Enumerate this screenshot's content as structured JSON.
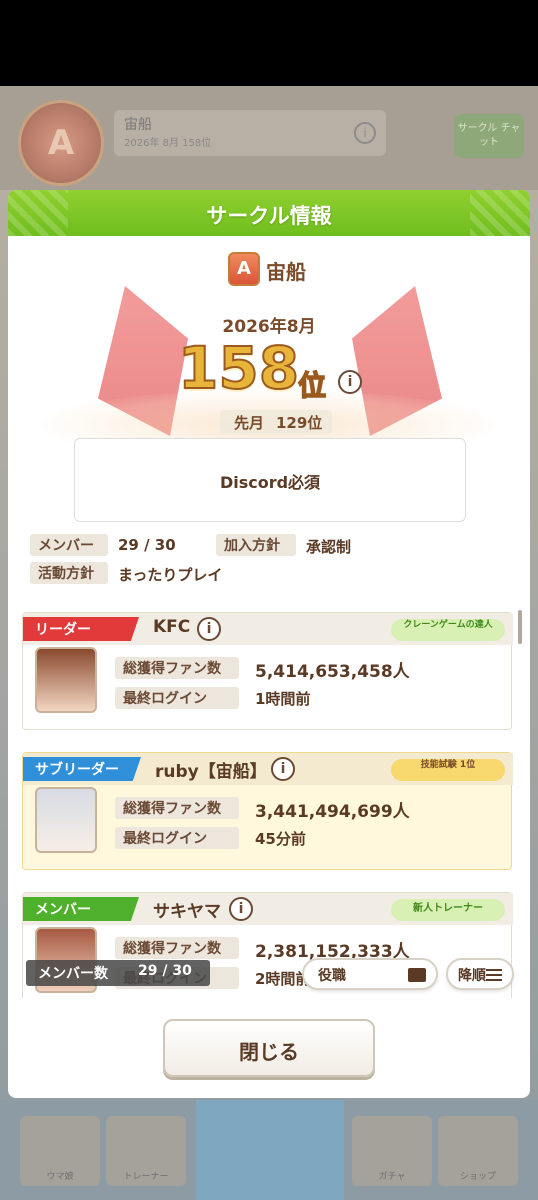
{
  "background": {
    "circle_name": "宙船",
    "circle_sub": "2026年 8月 158位",
    "side_button": "サークル\nチャット",
    "nav": [
      "ウマ娘",
      "トレーナー",
      "",
      "ガチャ",
      "ショップ"
    ]
  },
  "dialog": {
    "title": "サークル情報",
    "circle_rank_letter": "A",
    "circle_name": "宙船",
    "period": "2026年8月",
    "rank_number": "158",
    "rank_suffix": "位",
    "last_month_label": "先月",
    "last_month_value": "129位",
    "description": "Discord必須",
    "member_label": "メンバー",
    "member_value": "29 / 30",
    "join_policy_label": "加入方針",
    "join_policy_value": "承認制",
    "activity_label": "活動方針",
    "activity_value": "まったりプレイ"
  },
  "members": [
    {
      "role": "リーダー",
      "name": "KFC",
      "title_badge": "クレーンゲームの達人",
      "fans_label": "総獲得ファン数",
      "fans": "5,414,653,458人",
      "login_label": "最終ログイン",
      "login": "1時間前"
    },
    {
      "role": "サブリーダー",
      "name": "ruby【宙船】",
      "title_badge": "技能試験 1位",
      "fans_label": "総獲得ファン数",
      "fans": "3,441,494,699人",
      "login_label": "最終ログイン",
      "login": "45分前"
    },
    {
      "role": "メンバー",
      "name": "サキヤマ",
      "title_badge": "新人トレーナー",
      "fans_label": "総獲得ファン数",
      "fans": "2,381,152,333人",
      "login_label": "最終ログイン",
      "login": "2時間前"
    }
  ],
  "controls": {
    "member_count_label": "メンバー数",
    "member_count_value": "29 / 30",
    "sort_field": "役職",
    "sort_order": "降順",
    "close": "閉じる"
  },
  "colors": {
    "header_green": "#7cc625",
    "leader_red": "#e23a3a",
    "subleader_blue": "#2f8fd9",
    "member_green": "#4fb02b",
    "rank_gold": "#e8b43a"
  }
}
